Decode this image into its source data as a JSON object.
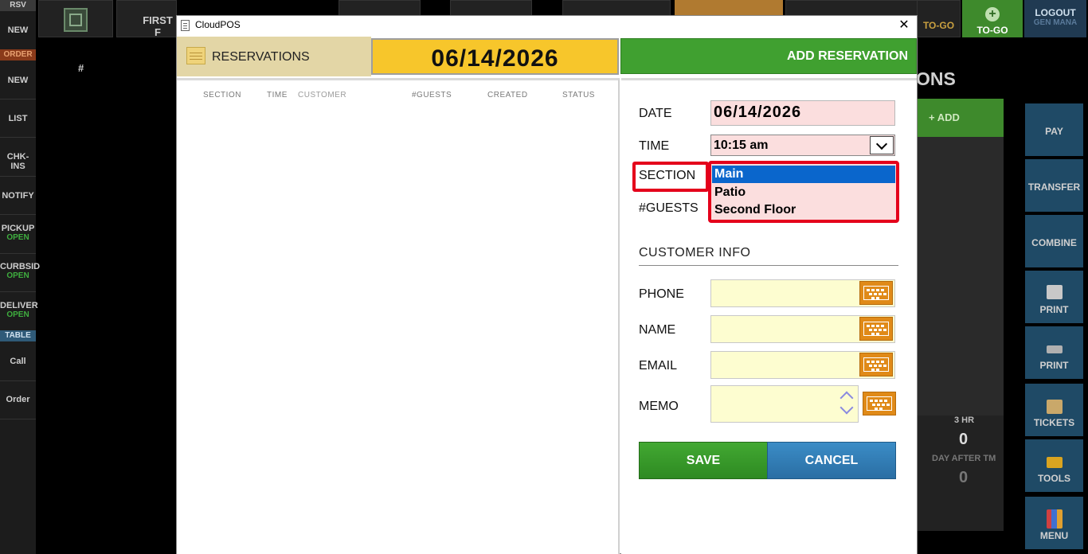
{
  "background": {
    "left_sidebar": [
      {
        "label": "RSV",
        "type": "header"
      },
      {
        "label": "NEW"
      },
      {
        "label": "ORDER",
        "type": "header"
      },
      {
        "label": "NEW"
      },
      {
        "label": "LIST"
      },
      {
        "label": "CHK-INS"
      },
      {
        "label": "NOTIFY"
      },
      {
        "label": "PICKUP",
        "sub": "OPEN"
      },
      {
        "label": "CURBSID",
        "sub": "OPEN"
      },
      {
        "label": "DELIVER",
        "sub": "OPEN"
      },
      {
        "label": "TABLE",
        "type": "header"
      },
      {
        "label": "Call"
      },
      {
        "label": "Order"
      }
    ],
    "hash_label": "#",
    "top_first_tab": "FIRST F",
    "top_togo_label": "TO-GO",
    "top_togo_green_label": "TO-GO",
    "logout_label": "LOGOUT",
    "logout_user": "GEN MANA",
    "sections_title_fragment": "ONS",
    "add_label": "+ ADD",
    "stats": {
      "hr_label": "3 HR",
      "hr_value": "0",
      "day_label": "DAY AFTER TM",
      "day_value": "0"
    },
    "right_sidebar": [
      "PAY",
      "TRANSFER",
      "COMBINE",
      "PRINT",
      "PRINT",
      "TICKETS",
      "TOOLS",
      "MENU"
    ]
  },
  "dialog": {
    "window_title": "CloudPOS",
    "close_symbol": "✕",
    "header_title": "RESERVATIONS",
    "date_banner": "06/14/2026",
    "add_reservation_label": "ADD RESERVATION",
    "list_columns": [
      "SECTION",
      "TIME",
      "CUSTOMER",
      "#GUESTS",
      "CREATED",
      "STATUS"
    ],
    "form": {
      "date_label": "DATE",
      "date_value": "06/14/2026",
      "time_label": "TIME",
      "time_value": "10:15 am",
      "section_label": "SECTION",
      "section_options": [
        "Main",
        "Patio",
        "Second Floor"
      ],
      "section_selected": "Main",
      "guests_label": "#GUESTS",
      "customer_info_title": "CUSTOMER INFO",
      "phone_label": "PHONE",
      "name_label": "NAME",
      "email_label": "EMAIL",
      "memo_label": "MEMO",
      "save_label": "SAVE",
      "cancel_label": "CANCEL"
    }
  },
  "colors": {
    "date_banner": "#f7c62b",
    "add_reservation": "#40a030",
    "highlight_red": "#e4001b",
    "selected_option": "#0a66cc",
    "save": "#42a832",
    "cancel": "#3b8cc6",
    "keyboard_icon": "#e08a18"
  }
}
